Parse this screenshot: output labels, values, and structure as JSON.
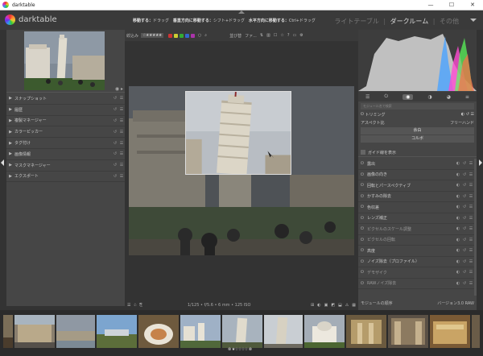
{
  "window": {
    "title": "darktable",
    "minimize": "—",
    "maximize": "☐",
    "close": "✕"
  },
  "header": {
    "logo_text": "darktable",
    "hints": [
      {
        "label": "移動する：",
        "value": "ドラッグ"
      },
      {
        "label": "垂直方向に移動する：",
        "value": "シフト+ドラッグ"
      },
      {
        "label": "水平方向に移動する：",
        "value": "Ctrl+ドラッグ"
      }
    ],
    "views": {
      "lighttable": "ライトテーブル",
      "darkroom": "ダークルーム",
      "other": "その他"
    }
  },
  "left_panel": {
    "modules": [
      {
        "label": "スナップショット"
      },
      {
        "label": "履歴"
      },
      {
        "label": "複製マネージャー"
      },
      {
        "label": "カラーピッカー"
      },
      {
        "label": "タグ付け"
      },
      {
        "label": "画像情報"
      },
      {
        "label": "マスクマネージャー"
      },
      {
        "label": "エクスポート"
      }
    ]
  },
  "top_toolbar": {
    "filter_label": "絞込み",
    "stars": "☆★★★★★",
    "color_labels": [
      "#c33",
      "#cc3",
      "#3a3",
      "#36c",
      "#a3a"
    ],
    "sort_label": "並び替",
    "sort_value": "ファ..."
  },
  "bottom_toolbar": {
    "info": "1/125 • f/5.6 • 6 mm • 125 ISO"
  },
  "right_panel": {
    "search_placeholder": "モジュール名で検索",
    "crop": {
      "title": "トリミング",
      "aspect_label": "アスペクト比",
      "aspect_value": "フリーハンド",
      "margins_btn": "余白",
      "shortcuts_btn": "コルボ"
    },
    "guides_label": "ガイド線を表示",
    "modules": [
      {
        "label": "露出",
        "dim": false
      },
      {
        "label": "画像の向き",
        "dim": false
      },
      {
        "label": "回転とパースペクティブ",
        "dim": false
      },
      {
        "label": "かすみの除去",
        "dim": false
      },
      {
        "label": "色収差",
        "dim": false
      },
      {
        "label": "レンズ補正",
        "dim": false
      },
      {
        "label": "ピクセルのスケール調整",
        "dim": true
      },
      {
        "label": "ピクセルの回転",
        "dim": true
      },
      {
        "label": "高度",
        "dim": false
      },
      {
        "label": "ノイズ除去（プロファイル）",
        "dim": false
      },
      {
        "label": "デモザイク",
        "dim": true
      },
      {
        "label": "RAWノイズ除去",
        "dim": true
      }
    ],
    "footer_left": "モジュールの順序",
    "footer_right": "バージョン3.0 RAW"
  },
  "filmstrip": {
    "caption": "⊗ ★☆☆☆☆ ⊗"
  },
  "colors": {
    "bg": "#333333",
    "panel": "#464646",
    "accent": "#ffffff"
  }
}
